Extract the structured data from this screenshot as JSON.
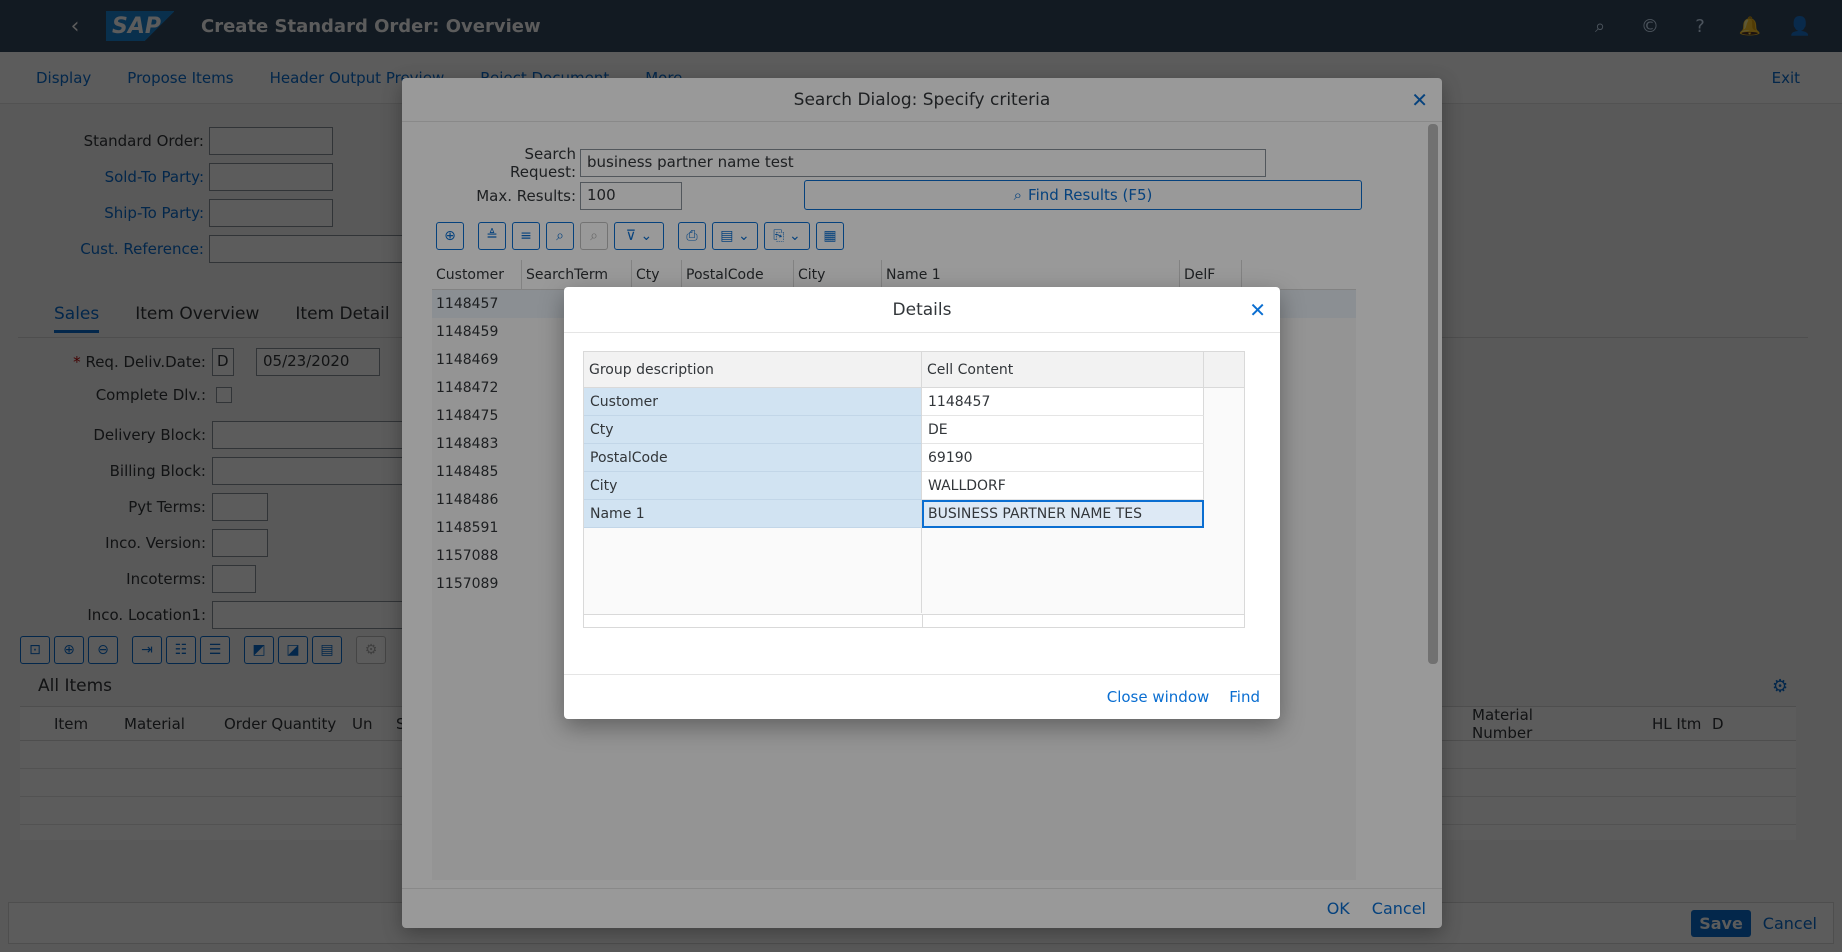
{
  "shell": {
    "logo": "SAP",
    "title": "Create Standard Order: Overview",
    "icons": [
      "search-icon",
      "copilot-icon",
      "help-icon",
      "notifications-icon",
      "user-icon"
    ]
  },
  "toolbar": {
    "items": [
      "Display",
      "Propose Items",
      "Header Output Preview",
      "Reject Document",
      "More"
    ],
    "exit": "Exit"
  },
  "header_form": {
    "standard_order": "Standard Order:",
    "sold_to": "Sold-To Party:",
    "ship_to": "Ship-To Party:",
    "cust_ref": "Cust. Reference:"
  },
  "tabs": [
    "Sales",
    "Item Overview",
    "Item Detail"
  ],
  "sales_form": {
    "req_deliv_date": "Req. Deliv.Date:",
    "req_deliv_format": "D",
    "req_deliv_value": "05/23/2020",
    "complete_dlv": "Complete Dlv.:",
    "delivery_block": "Delivery Block:",
    "billing_block": "Billing Block:",
    "pyt_terms": "Pyt Terms:",
    "inco_version": "Inco. Version:",
    "incoterms": "Incoterms:",
    "inco_location1": "Inco. Location1:"
  },
  "items": {
    "title": "All Items",
    "columns": [
      "Item",
      "Material",
      "Order Quantity",
      "Un",
      "S",
      "Material Number",
      "HL Itm",
      "D"
    ]
  },
  "footer": {
    "save": "Save",
    "cancel": "Cancel"
  },
  "search_dialog": {
    "title": "Search Dialog: Specify criteria",
    "search_request_label": "Search Request:",
    "search_request_value": "business partner name test",
    "max_results_label": "Max. Results:",
    "max_results_value": "100",
    "find_button": "Find Results (F5)",
    "columns": [
      "Customer",
      "SearchTerm",
      "Cty",
      "PostalCode",
      "City",
      "Name 1",
      "DelF"
    ],
    "rows": [
      "1148457",
      "1148459",
      "1148469",
      "1148472",
      "1148475",
      "1148483",
      "1148485",
      "1148486",
      "1148591",
      "1157088",
      "1157089"
    ],
    "ok": "OK",
    "cancel": "Cancel"
  },
  "details_dialog": {
    "title": "Details",
    "col_group": "Group description",
    "col_content": "Cell Content",
    "rows": [
      {
        "group": "Customer",
        "content": "1148457"
      },
      {
        "group": "Cty",
        "content": "DE"
      },
      {
        "group": "PostalCode",
        "content": "69190"
      },
      {
        "group": "City",
        "content": "WALLDORF"
      },
      {
        "group": "Name 1",
        "content": "BUSINESS PARTNER NAME TES"
      }
    ],
    "close_window": "Close window",
    "find": "Find"
  },
  "colors": {
    "shell": "#354a5f",
    "accent": "#0a6ed1",
    "selection": "#d1e3f2"
  }
}
